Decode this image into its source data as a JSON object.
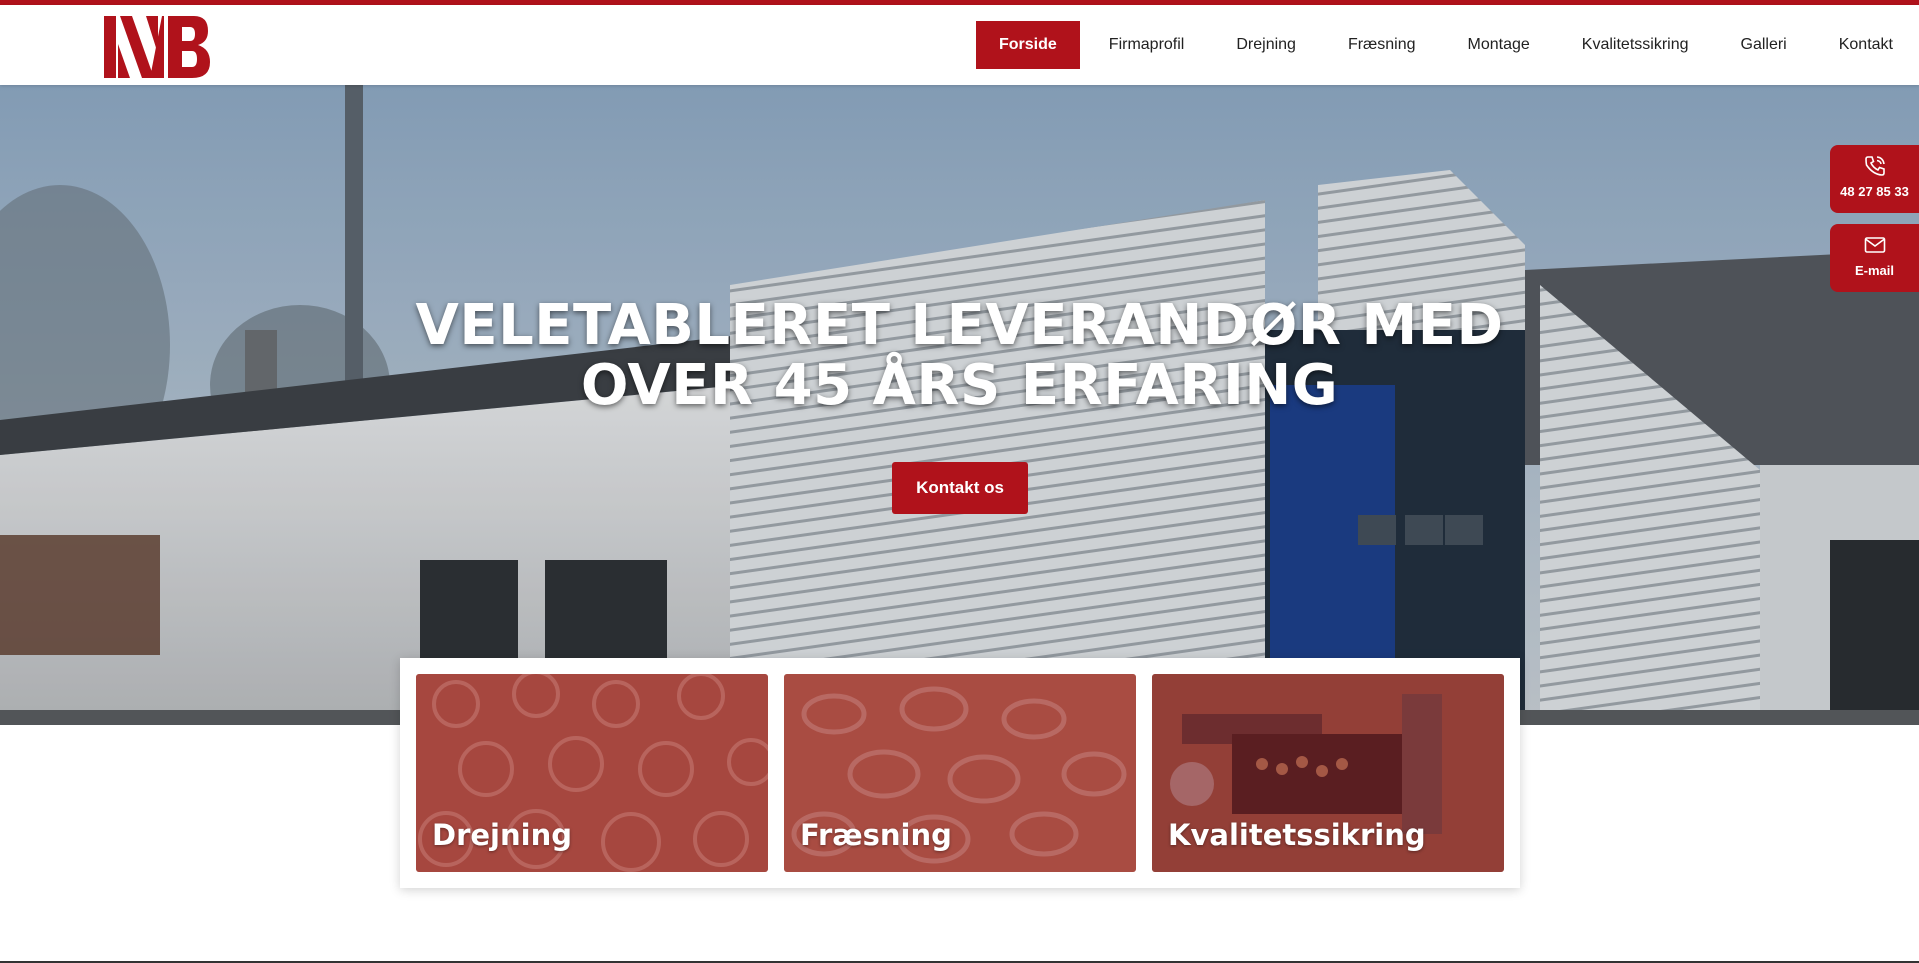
{
  "brand": {
    "logo_text": "NB",
    "accent_color": "#b0121b"
  },
  "nav": {
    "items": [
      {
        "label": "Forside",
        "active": true
      },
      {
        "label": "Firmaprofil"
      },
      {
        "label": "Drejning"
      },
      {
        "label": "Fræsning"
      },
      {
        "label": "Montage"
      },
      {
        "label": "Kvalitetssikring"
      },
      {
        "label": "Galleri"
      },
      {
        "label": "Kontakt"
      }
    ]
  },
  "hero": {
    "title_line1": "VELETABLERET LEVERANDØR MED",
    "title_line2": "OVER 45 ÅRS ERFARING",
    "cta_label": "Kontakt os"
  },
  "side": {
    "phone": {
      "icon": "phone-icon",
      "label": "48 27 85 33"
    },
    "email": {
      "icon": "mail-icon",
      "label": "E-mail"
    }
  },
  "cards": [
    {
      "label": "Drejning"
    },
    {
      "label": "Fræsning"
    },
    {
      "label": "Kvalitetssikring"
    }
  ]
}
